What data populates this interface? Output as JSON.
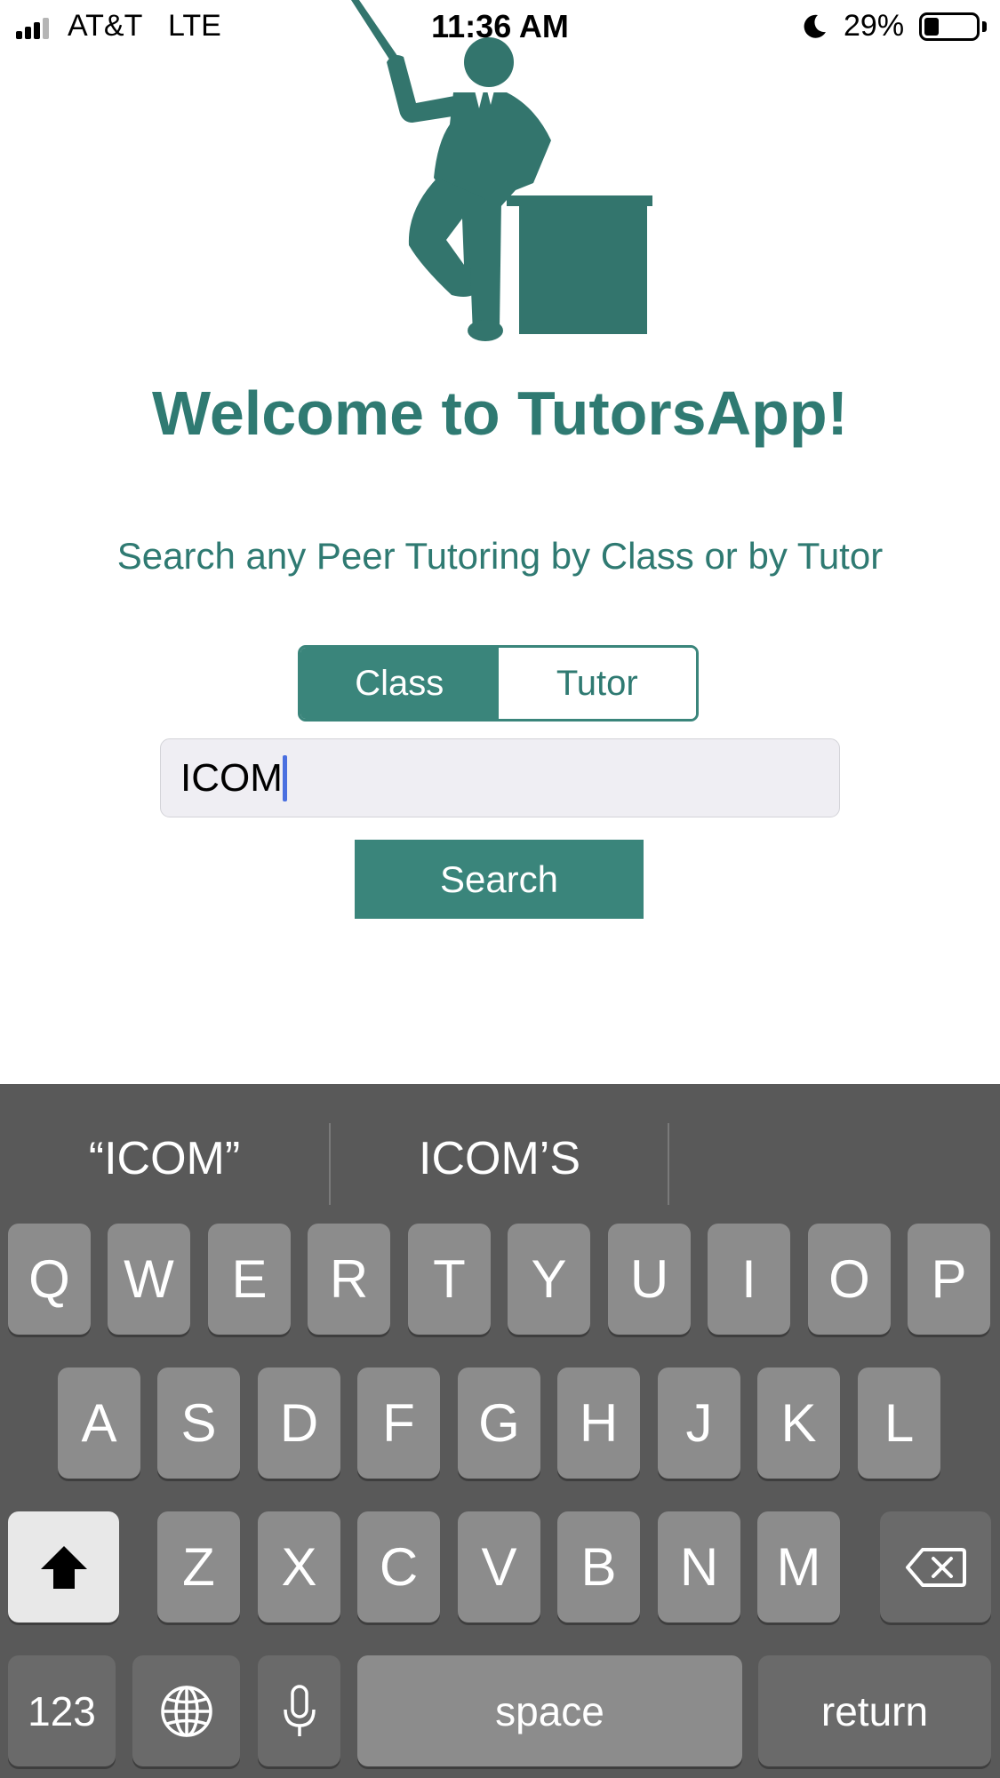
{
  "status_bar": {
    "carrier": "AT&T",
    "network": "LTE",
    "time": "11:36 AM",
    "battery_percent_label": "29%",
    "battery_level": 0.29,
    "signal_bars": 3,
    "icons": [
      "signal-bars-icon",
      "moon-icon",
      "battery-icon"
    ]
  },
  "hero": {
    "icon": "teacher-icon",
    "title": "Welcome to TutorsApp!",
    "subtitle": "Search any Peer Tutoring by Class or by Tutor"
  },
  "search_mode": {
    "options": [
      {
        "label": "Class",
        "selected": true
      },
      {
        "label": "Tutor",
        "selected": false
      }
    ]
  },
  "search": {
    "value": "ICOM",
    "button_label": "Search"
  },
  "colors": {
    "accent": "#3a857b",
    "accent_text": "#2f7a72",
    "keyboard_bg": "#595959",
    "key_bg": "#8c8c8c",
    "caret": "#4a6fe0"
  },
  "keyboard": {
    "suggestions": [
      "“ICOM”",
      "ICOM’S",
      ""
    ],
    "row1": [
      "Q",
      "W",
      "E",
      "R",
      "T",
      "Y",
      "U",
      "I",
      "O",
      "P"
    ],
    "row2": [
      "A",
      "S",
      "D",
      "F",
      "G",
      "H",
      "J",
      "K",
      "L"
    ],
    "row3": [
      "Z",
      "X",
      "C",
      "V",
      "B",
      "N",
      "M"
    ],
    "numbers_label": "123",
    "space_label": "space",
    "return_label": "return",
    "icons": [
      "shift-icon",
      "delete-icon",
      "globe-icon",
      "microphone-icon"
    ]
  }
}
